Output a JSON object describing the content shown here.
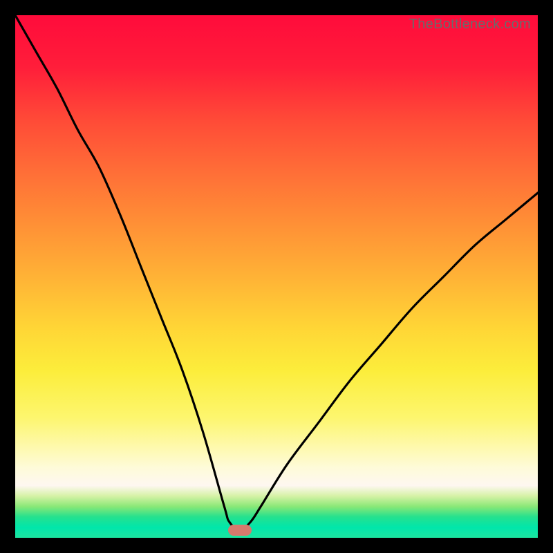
{
  "watermark": "TheBottleneck.com",
  "colors": {
    "frame": "#000000",
    "curve": "#000000",
    "marker": "#d67a6d",
    "gradient_top": "#ff0b3b",
    "gradient_bottom": "#1de5a0"
  },
  "chart_data": {
    "type": "line",
    "title": "",
    "xlabel": "",
    "ylabel": "",
    "xlim": [
      0,
      100
    ],
    "ylim": [
      0,
      100
    ],
    "grid": false,
    "legend": false,
    "marker": {
      "x": 43,
      "y": 1.5
    },
    "series": [
      {
        "name": "bottleneck-curve",
        "x": [
          0,
          4,
          8,
          12,
          16,
          20,
          24,
          28,
          32,
          36,
          40,
          41,
          43,
          45,
          47,
          52,
          58,
          64,
          70,
          76,
          82,
          88,
          94,
          100
        ],
        "y": [
          100,
          93,
          86,
          78,
          71,
          62,
          52,
          42,
          32,
          20,
          6,
          3,
          1.5,
          3,
          6,
          14,
          22,
          30,
          37,
          44,
          50,
          56,
          61,
          66
        ]
      }
    ],
    "annotations": []
  }
}
